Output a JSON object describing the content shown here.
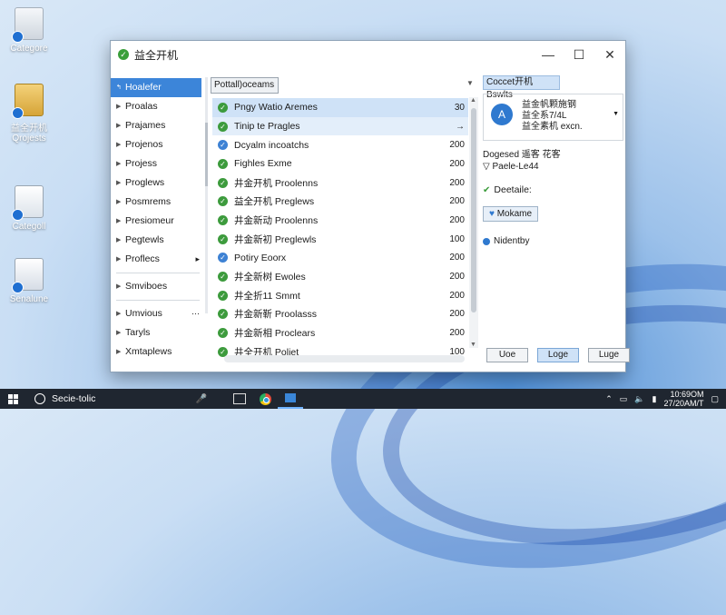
{
  "desktop": {
    "icons": [
      {
        "label": "Categore"
      },
      {
        "label": "益全开机\nQrojests"
      },
      {
        "label": "Categoll"
      },
      {
        "label": "Senalune"
      }
    ]
  },
  "window": {
    "title": "益全开机",
    "controls": {
      "minimize": "—",
      "maximize": "☐",
      "close": "✕"
    }
  },
  "sidebar": {
    "items": [
      {
        "label": "Hoalefer",
        "selected": true
      },
      {
        "label": "Proalas"
      },
      {
        "label": "Prajames"
      },
      {
        "label": "Projenos"
      },
      {
        "label": "Projess"
      },
      {
        "label": "Proglews"
      },
      {
        "label": "Posmrems"
      },
      {
        "label": "Presiomeur"
      },
      {
        "label": "Pegtewls"
      },
      {
        "label": "Proflecs",
        "more": "▸"
      }
    ],
    "items2": [
      {
        "label": "Smviboes"
      },
      {
        "label": "Umvious",
        "more": "⋯"
      },
      {
        "label": "Taryls"
      },
      {
        "label": "Xmtaplews"
      }
    ]
  },
  "list": {
    "filter_label": "Pottall)oceams",
    "rows": [
      {
        "label": "Pngy Watio Aremes",
        "value": "30",
        "icon": "check",
        "state": "sel"
      },
      {
        "label": "Tinip te Pragles",
        "value": "→",
        "icon": "check",
        "state": "sel2"
      },
      {
        "label": "Dcyalm incoatchs",
        "value": "200",
        "icon": "blue"
      },
      {
        "label": "Fighles Exme",
        "value": "200",
        "icon": "check"
      },
      {
        "label": "井金开机 Proolenns",
        "value": "200",
        "icon": "check"
      },
      {
        "label": "益全开机 Preglews",
        "value": "200",
        "icon": "check"
      },
      {
        "label": "井金新动 Proolenns",
        "value": "200",
        "icon": "check"
      },
      {
        "label": "井金新初 Preglewls",
        "value": "100",
        "icon": "check"
      },
      {
        "label": "Potiry Eoorx",
        "value": "200",
        "icon": "blue"
      },
      {
        "label": "井全新树 Ewoles",
        "value": "200",
        "icon": "check"
      },
      {
        "label": "井全折11 Smmt",
        "value": "200",
        "icon": "check"
      },
      {
        "label": "井金新靳 Proolasss",
        "value": "200",
        "icon": "check"
      },
      {
        "label": "井金新相 Proclears",
        "value": "200",
        "icon": "check"
      },
      {
        "label": "井全开机 Poliet",
        "value": "100",
        "icon": "check"
      }
    ]
  },
  "detail": {
    "header": "Coccet开机 Bswlts",
    "card": {
      "line1": "益金帆颗施钢",
      "line2": "益全系7/4L",
      "line3": "益全素机 excn."
    },
    "prop1": "Dogesed 遥客 花客",
    "prop2": "Paele-Le44",
    "status_label": "Deetaile:",
    "button_label": "Mokame",
    "identity_label": "Nidentby"
  },
  "footer": {
    "buttons": [
      {
        "label": "Uoe"
      },
      {
        "label": "Loge",
        "primary": true
      },
      {
        "label": "Luge"
      }
    ]
  },
  "taskbar": {
    "search_text": "Secie-tolic",
    "clock_time": "10:69OM",
    "clock_date": "27/20AM/T"
  }
}
